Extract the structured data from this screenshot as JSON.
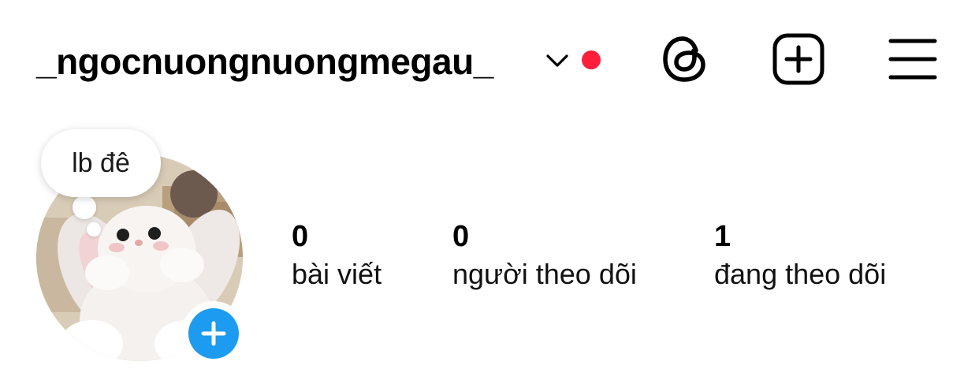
{
  "header": {
    "username": "_ngocnuongnuongmegau_",
    "icons": {
      "account_switch": "chevron-down-icon",
      "notification": "red-dot",
      "threads": "threads-icon",
      "create": "plus-square-icon",
      "menu": "hamburger-menu-icon"
    },
    "notification_color": "#ff1f3d"
  },
  "profile": {
    "note_text": "lb đê",
    "avatar_alt": "avatar",
    "add_story_icon": "plus-icon",
    "add_story_color": "#1d9bf0"
  },
  "stats": [
    {
      "count": "0",
      "label": "bài viết"
    },
    {
      "count": "0",
      "label": "người theo dõi"
    },
    {
      "count": "1",
      "label": "đang theo dõi"
    }
  ]
}
